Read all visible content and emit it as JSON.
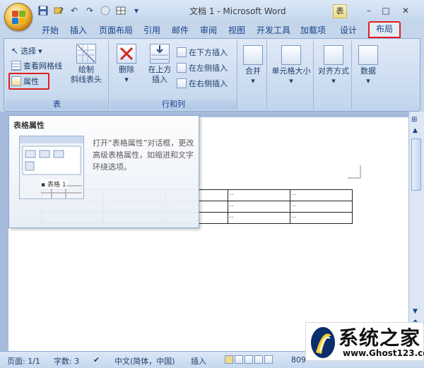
{
  "window": {
    "title": "文档 1 - Microsoft Word",
    "context_tab_label": "表",
    "controls": [
      "–",
      "□",
      "✕"
    ]
  },
  "tabs": [
    "开始",
    "插入",
    "页面布局",
    "引用",
    "邮件",
    "审阅",
    "视图",
    "开发工具",
    "加载项",
    "设计",
    "布局"
  ],
  "active_tab": "布局",
  "ribbon": {
    "table_group": {
      "label": "表",
      "select": "选择",
      "select_caret": "▾",
      "gridlines": "查看网格线",
      "properties": "属性",
      "draw_line1": "绘制",
      "draw_line2": "斜线表头"
    },
    "rows_cols_group": {
      "label": "行和列",
      "delete": "删除",
      "insert_above_line1": "在上方",
      "insert_above_line2": "插入",
      "insert_below": "在下方插入",
      "insert_left": "在左侧插入",
      "insert_right": "在右侧插入"
    },
    "merge": "合并",
    "cell_size": "单元格大小",
    "alignment": "对齐方式",
    "data": "数据"
  },
  "tooltip": {
    "title": "表格属性",
    "body": "打开“表格属性”对话框，更改高级表格属性，如缩进和文字环绕选项。",
    "thumb_caption": "▪ 表格 1."
  },
  "table": {
    "rows": 3,
    "cols": 5,
    "cell_mark": ".."
  },
  "status": {
    "page": "页面: 1/1",
    "words": "字数: 3",
    "language": "中文(简体，中国)",
    "mode": "插入",
    "zoom": "809"
  },
  "watermark": {
    "brand": "系统之家",
    "url": "www.Ghost123.com"
  },
  "colors": {
    "ribbon_bg": "#dfe9f6",
    "highlight": "#e02020",
    "text": "#15428b"
  }
}
